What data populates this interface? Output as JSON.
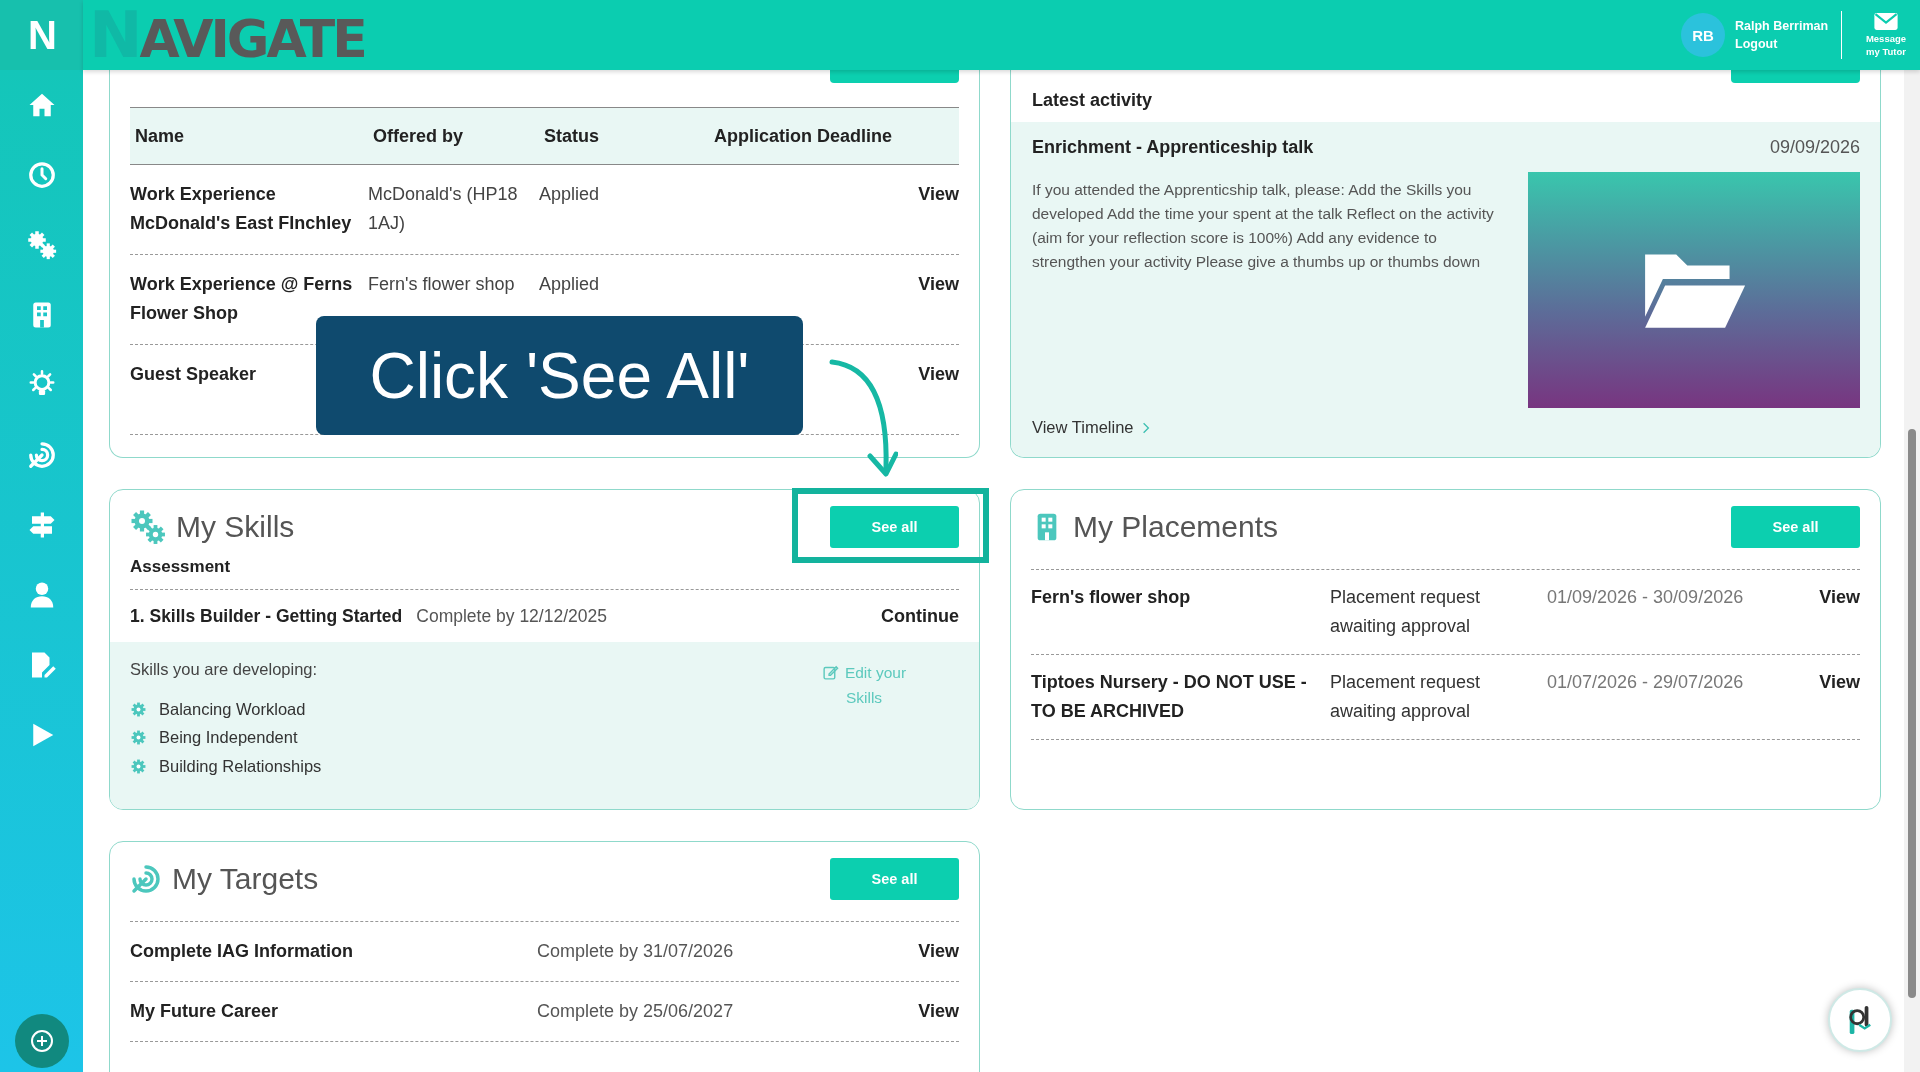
{
  "header": {
    "logo_letter": "N",
    "brand": "NAVIGATE",
    "user": {
      "initials": "RB",
      "name": "Ralph Berriman",
      "logout": "Logout"
    },
    "message": "Message my Tutor"
  },
  "sidebar": {
    "items": [
      {
        "kind": "home"
      },
      {
        "kind": "clock"
      },
      {
        "kind": "gears"
      },
      {
        "kind": "building"
      },
      {
        "kind": "bulb"
      },
      {
        "kind": "target"
      },
      {
        "kind": "signpost"
      },
      {
        "kind": "person"
      },
      {
        "kind": "edit"
      },
      {
        "kind": "play"
      }
    ]
  },
  "opportunities": {
    "columns": [
      "Name",
      "Offered by",
      "Status",
      "Application Deadline"
    ],
    "rows": [
      {
        "name": "Work Experience McDonald's East FInchley",
        "offered_by": "McDonald's (HP18 1AJ)",
        "status": "Applied",
        "action": "View"
      },
      {
        "name": "Work Experience @ Ferns Flower Shop",
        "offered_by": "Fern's flower shop",
        "status": "Applied",
        "action": "View"
      },
      {
        "name": "Guest Speaker",
        "action": "View"
      }
    ]
  },
  "activity": {
    "heading": "Latest activity",
    "title": "Enrichment - Apprenticeship talk",
    "date": "09/09/2026",
    "description": "If you attended the Apprenticship talk, please: Add the Skills you developed Add the time your spent at the talk Reflect on the activity (aim for your reflection score is 100%) Add any evidence to strengthen your activity Please give a thumbs up or thumbs down",
    "link": "View Timeline"
  },
  "skills": {
    "title": "My Skills",
    "button": "See all",
    "subtitle": "Assessment",
    "assessment": {
      "name": "1. Skills Builder - Getting Started",
      "due": "Complete by 12/12/2025",
      "action": "Continue"
    },
    "developing_label": "Skills you are developing:",
    "edit_link": "Edit your Skills",
    "items": [
      "Balancing Workload",
      "Being Independent",
      "Building Relationships"
    ]
  },
  "placements": {
    "title": "My Placements",
    "button": "See all",
    "rows": [
      {
        "name": "Fern's flower shop",
        "status": "Placement request awaiting approval",
        "dates": "01/09/2026 - 30/09/2026",
        "action": "View"
      },
      {
        "name": "Tiptoes Nursery - DO NOT USE - TO BE ARCHIVED",
        "status": "Placement request awaiting approval",
        "dates": "01/07/2026 - 29/07/2026",
        "action": "View"
      }
    ]
  },
  "targets": {
    "title": "My Targets",
    "button": "See all",
    "rows": [
      {
        "name": "Complete IAG Information",
        "due": "Complete by 31/07/2026",
        "action": "View"
      },
      {
        "name": "My Future Career",
        "due": "Complete by 25/06/2027",
        "action": "View"
      }
    ]
  },
  "callout": {
    "text": "Click 'See All'"
  }
}
